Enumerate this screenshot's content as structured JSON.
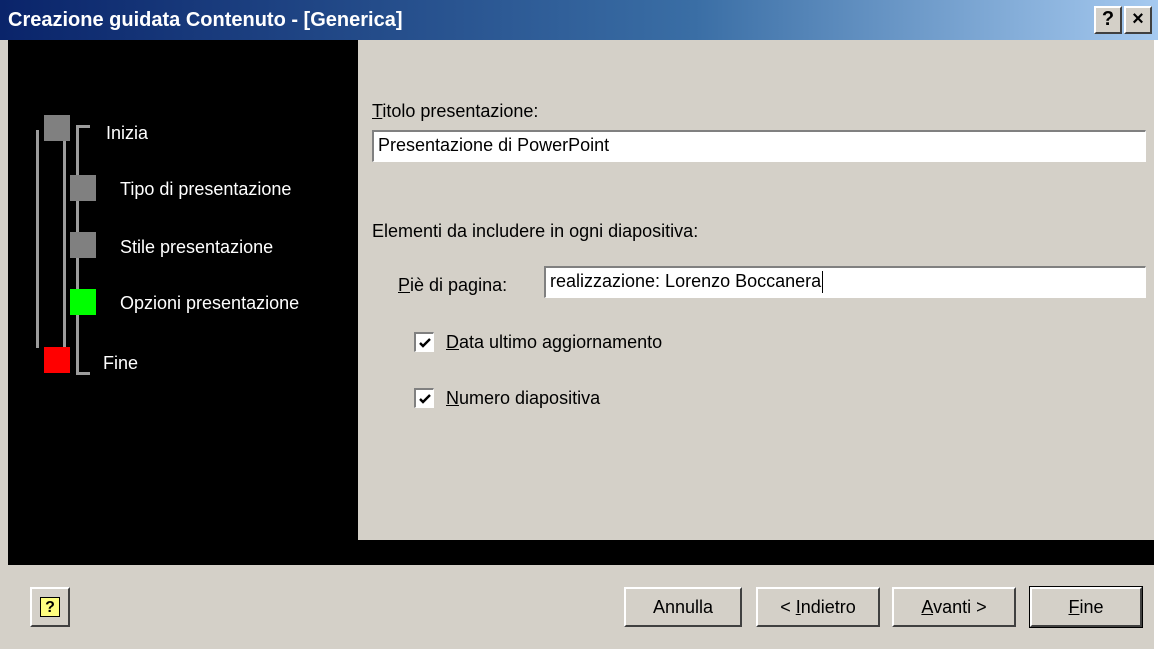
{
  "window": {
    "title": "Creazione guidata Contenuto - [Generica]",
    "help_button": "?",
    "close_button": "×"
  },
  "steps": [
    {
      "label": "Inizia",
      "color": "#808080"
    },
    {
      "label": "Tipo di presentazione",
      "color": "#808080"
    },
    {
      "label": "Stile presentazione",
      "color": "#808080"
    },
    {
      "label": "Opzioni presentazione",
      "color": "#00ff00"
    },
    {
      "label": "Fine",
      "color": "#ff0000"
    }
  ],
  "form": {
    "title_label_first": "T",
    "title_label_rest": "itolo presentazione:",
    "title_value": "Presentazione di PowerPoint",
    "elements_label": "Elementi da includere in ogni diapositiva:",
    "footer_label_first": "P",
    "footer_label_rest": "iè di pagina:",
    "footer_value": "realizzazione: Lorenzo Boccanera",
    "date_checkbox": {
      "checked": true,
      "label_first": "D",
      "label_rest": "ata ultimo aggiornamento"
    },
    "number_checkbox": {
      "checked": true,
      "label_first": "N",
      "label_rest": "umero diapositiva"
    }
  },
  "buttons": {
    "help_icon": "?",
    "cancel": "Annulla",
    "back_prefix": "< ",
    "back_first": "I",
    "back_rest": "ndietro",
    "next_first": "A",
    "next_rest": "vanti >",
    "finish_first": "F",
    "finish_rest": "ine"
  }
}
